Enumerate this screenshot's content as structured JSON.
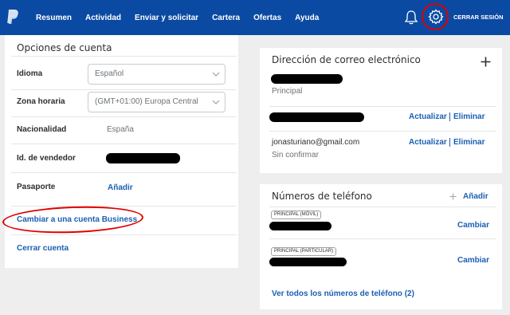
{
  "nav": {
    "items": [
      "Resumen",
      "Actividad",
      "Enviar y solicitar",
      "Cartera",
      "Ofertas",
      "Ayuda"
    ],
    "logout": "CERRAR SESIÓN"
  },
  "account": {
    "title": "Opciones de cuenta",
    "language_label": "Idioma",
    "language_value": "Español",
    "timezone_label": "Zona horaria",
    "timezone_value": "(GMT+01:00) Europa Central",
    "nationality_label": "Nacionalidad",
    "nationality_value": "España",
    "seller_id_label": "Id. de vendedor",
    "passport_label": "Pasaporte",
    "passport_action": "Añadir",
    "business_link": "Cambiar a una cuenta Business",
    "close_link": "Cerrar cuenta"
  },
  "email": {
    "title": "Dirección de correo electrónico",
    "add_icon": "plus-icon",
    "primary_label": "Principal",
    "update": "Actualizar",
    "remove": "Eliminar",
    "third_email": "jonasturiano@gmail.com",
    "unconfirmed": "Sin confirmar"
  },
  "phone": {
    "title": "Números de teléfono",
    "add": "Añadir",
    "badge_mobile": "PRINCIPAL (MÓVIL)",
    "badge_home": "PRINCIPAL (PARTICULAR)",
    "change": "Cambiar",
    "see_all": "Ver todos los números de teléfono (2)"
  },
  "colors": {
    "nav_bg": "#0b4aa2",
    "link": "#1a5fb4",
    "annotation": "#e00000"
  }
}
